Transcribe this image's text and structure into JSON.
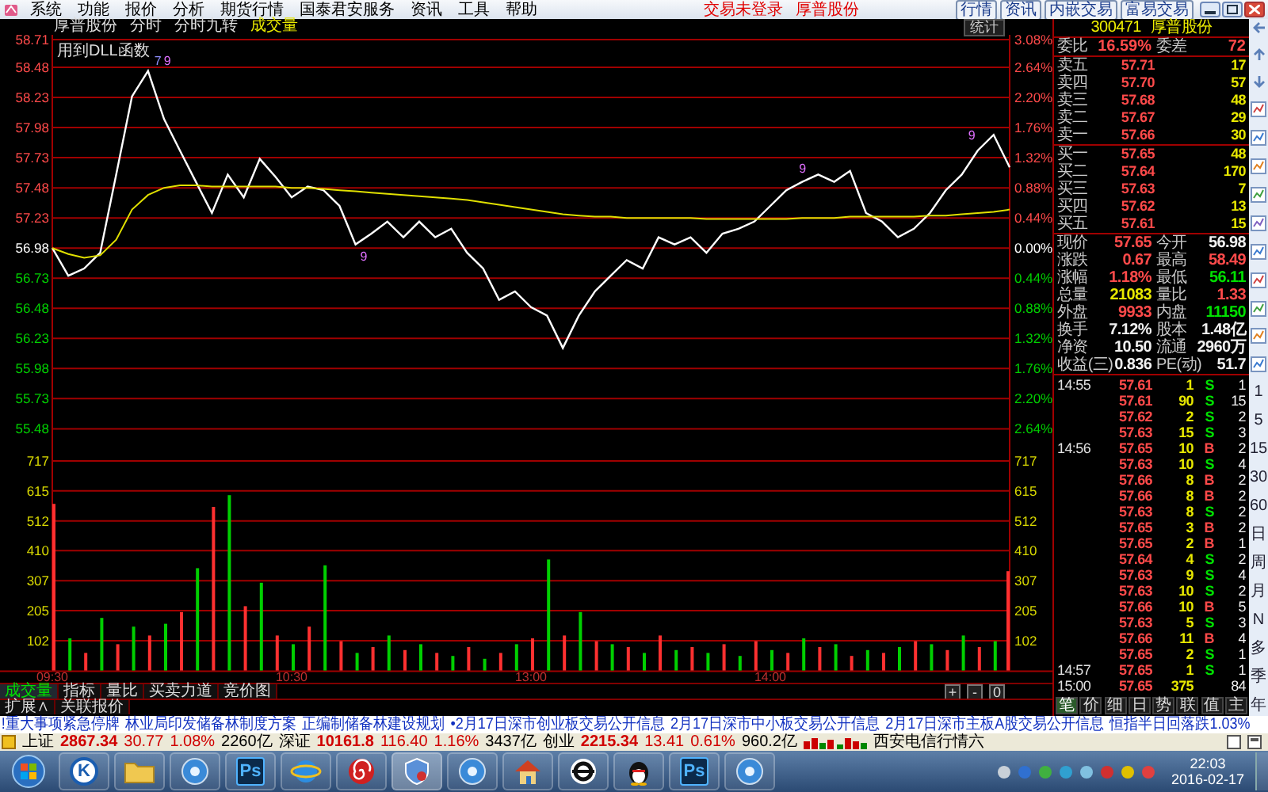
{
  "menu": {
    "items": [
      "系统",
      "功能",
      "报价",
      "分析",
      "期货行情",
      "国泰君安服务",
      "资讯",
      "工具",
      "帮助"
    ],
    "status": [
      "交易未登录",
      "厚普股份"
    ],
    "buttons": [
      "行情",
      "资讯",
      "内嵌交易",
      "富易交易"
    ]
  },
  "chart_header": {
    "title": "厚普股份",
    "items": [
      "分时",
      "分时九转"
    ],
    "indicator": "成交量",
    "stats_button": "统计",
    "note": "用到DLL函数"
  },
  "price_chart": {
    "chart_data": {
      "type": "line",
      "grid": true,
      "categories": [
        null,
        null,
        null,
        null,
        null,
        null,
        null,
        null,
        null,
        null,
        null,
        null,
        null,
        null,
        null,
        null,
        null,
        null,
        null,
        null,
        null,
        null,
        null,
        null,
        null,
        null,
        null,
        null,
        null,
        null,
        null,
        null,
        null,
        null,
        null,
        null,
        null,
        null,
        null,
        null,
        null,
        null,
        null,
        null,
        null,
        null,
        null,
        null,
        null,
        null,
        null,
        null,
        null,
        null,
        null,
        null,
        null,
        null,
        null,
        null,
        null
      ],
      "ylim": [
        55.48,
        58.71
      ],
      "series": [
        {
          "color": "#ffffff",
          "values": [
            56.98,
            56.75,
            56.81,
            56.94,
            57.59,
            58.24,
            58.45,
            58.05,
            57.79,
            57.53,
            57.27,
            57.59,
            57.4,
            57.72,
            57.57,
            57.4,
            57.49,
            57.46,
            57.33,
            57.01,
            57.1,
            57.2,
            57.07,
            57.2,
            57.07,
            57.14,
            56.94,
            56.81,
            56.55,
            56.62,
            56.49,
            56.42,
            56.15,
            56.42,
            56.62,
            56.75,
            56.88,
            56.81,
            57.07,
            57.01,
            57.07,
            56.94,
            57.1,
            57.14,
            57.2,
            57.33,
            57.46,
            57.53,
            57.59,
            57.53,
            57.62,
            57.27,
            57.2,
            57.07,
            57.14,
            57.27,
            57.46,
            57.59,
            57.79,
            57.92,
            57.65
          ]
        },
        {
          "color": "#e0e000",
          "values": [
            56.98,
            56.93,
            56.9,
            56.92,
            57.05,
            57.3,
            57.42,
            57.48,
            57.5,
            57.5,
            57.49,
            57.49,
            57.49,
            57.49,
            57.49,
            57.48,
            57.48,
            57.47,
            57.46,
            57.45,
            57.44,
            57.43,
            57.42,
            57.41,
            57.4,
            57.39,
            57.38,
            57.36,
            57.34,
            57.32,
            57.3,
            57.28,
            57.26,
            57.25,
            57.24,
            57.24,
            57.23,
            57.23,
            57.23,
            57.23,
            57.23,
            57.22,
            57.22,
            57.22,
            57.22,
            57.22,
            57.22,
            57.23,
            57.23,
            57.23,
            57.24,
            57.24,
            57.24,
            57.24,
            57.24,
            57.25,
            57.25,
            57.26,
            57.27,
            57.28,
            57.3
          ]
        }
      ],
      "yticks": [
        58.71,
        58.48,
        58.23,
        57.98,
        57.73,
        57.48,
        57.23,
        56.98,
        56.73,
        56.48,
        56.23,
        55.98,
        55.73,
        55.48
      ],
      "annotations": [
        "7",
        "9",
        "9",
        "9",
        "9"
      ]
    },
    "pct_axis": [
      {
        "label": "3.08%",
        "color": "#ff4a4a"
      },
      {
        "label": "2.64%",
        "color": "#ff4a4a"
      },
      {
        "label": "2.20%",
        "color": "#ff4a4a"
      },
      {
        "label": "1.76%",
        "color": "#ff4a4a"
      },
      {
        "label": "1.32%",
        "color": "#ff4a4a"
      },
      {
        "label": "0.88%",
        "color": "#ff4a4a"
      },
      {
        "label": "0.44%",
        "color": "#ff4a4a"
      },
      {
        "label": "0.00%",
        "color": "#ffffff"
      },
      {
        "label": "0.44%",
        "color": "#00d000"
      },
      {
        "label": "0.88%",
        "color": "#00d000"
      },
      {
        "label": "1.32%",
        "color": "#00d000"
      },
      {
        "label": "1.76%",
        "color": "#00d000"
      },
      {
        "label": "2.20%",
        "color": "#00d000"
      },
      {
        "label": "2.64%",
        "color": "#00d000"
      }
    ]
  },
  "volume_chart": {
    "right_axis": [
      "717",
      "615",
      "512",
      "410",
      "307",
      "205",
      "102"
    ],
    "chart_data": {
      "type": "bar",
      "grid": true,
      "ylim": [
        0,
        717
      ],
      "categories": [
        "09:30",
        null,
        null,
        null,
        null,
        null,
        null,
        null,
        null,
        null,
        null,
        null,
        null,
        null,
        null,
        "10:30",
        null,
        null,
        null,
        null,
        null,
        null,
        null,
        null,
        null,
        null,
        null,
        null,
        null,
        null,
        "13:00",
        null,
        null,
        null,
        null,
        null,
        null,
        null,
        null,
        null,
        null,
        null,
        null,
        null,
        null,
        "14:00",
        null,
        null,
        null,
        null,
        null,
        null,
        null,
        null,
        null,
        null,
        null,
        null,
        null,
        null,
        null
      ],
      "series": [
        {
          "color": "#ff3030",
          "values": [
            570,
            null,
            60,
            null,
            90,
            null,
            120,
            null,
            200,
            null,
            560,
            null,
            220,
            null,
            120,
            null,
            150,
            null,
            100,
            null,
            80,
            null,
            70,
            null,
            60,
            null,
            80,
            null,
            60,
            null,
            110,
            null,
            120,
            null,
            100,
            null,
            80,
            null,
            120,
            null,
            80,
            null,
            90,
            null,
            100,
            null,
            60,
            null,
            80,
            null,
            50,
            null,
            60,
            null,
            100,
            null,
            70,
            null,
            80,
            null,
            340
          ]
        },
        {
          "color": "#00d000",
          "values": [
            null,
            110,
            null,
            180,
            null,
            150,
            null,
            160,
            null,
            350,
            null,
            600,
            null,
            300,
            null,
            90,
            null,
            360,
            null,
            60,
            null,
            120,
            null,
            90,
            null,
            50,
            null,
            40,
            null,
            90,
            null,
            380,
            null,
            200,
            null,
            90,
            null,
            60,
            null,
            70,
            null,
            60,
            null,
            50,
            null,
            70,
            null,
            110,
            null,
            90,
            null,
            70,
            null,
            80,
            null,
            90,
            null,
            120,
            null,
            100,
            null
          ]
        }
      ],
      "yticks": [
        717,
        615,
        512,
        410,
        307,
        205,
        102
      ]
    }
  },
  "bottom_tabs": [
    {
      "label": "成交量",
      "selected": true
    },
    {
      "label": "指标",
      "selected": false
    },
    {
      "label": "量比",
      "selected": false
    },
    {
      "label": "买卖力道",
      "selected": false
    },
    {
      "label": "竞价图",
      "selected": false
    }
  ],
  "zoom_buttons": [
    "+",
    "-",
    "0"
  ],
  "bottom_links": [
    "扩展∧",
    "关联报价"
  ],
  "quote": {
    "code": "300471",
    "name": "厚普股份",
    "order_ratio": [
      {
        "label": "委比",
        "value": "16.59%"
      },
      {
        "label": "委差",
        "value": "72"
      }
    ],
    "asks": [
      {
        "label": "卖五",
        "price": "57.71",
        "volume": "17"
      },
      {
        "label": "卖四",
        "price": "57.70",
        "volume": "57"
      },
      {
        "label": "卖三",
        "price": "57.68",
        "volume": "48"
      },
      {
        "label": "卖二",
        "price": "57.67",
        "volume": "29"
      },
      {
        "label": "卖一",
        "price": "57.66",
        "volume": "30"
      }
    ],
    "bids": [
      {
        "label": "买一",
        "price": "57.65",
        "volume": "48"
      },
      {
        "label": "买二",
        "price": "57.64",
        "volume": "170"
      },
      {
        "label": "买三",
        "price": "57.63",
        "volume": "7"
      },
      {
        "label": "买四",
        "price": "57.62",
        "volume": "13"
      },
      {
        "label": "买五",
        "price": "57.61",
        "volume": "15"
      }
    ],
    "stats": [
      [
        {
          "label": "现价",
          "value": "57.65",
          "color": "#ff4a4a"
        },
        {
          "label": "今开",
          "value": "56.98",
          "color": "#f0f0f0"
        }
      ],
      [
        {
          "label": "涨跌",
          "value": "0.67",
          "color": "#ff4a4a"
        },
        {
          "label": "最高",
          "value": "58.49",
          "color": "#ff4a4a"
        }
      ],
      [
        {
          "label": "涨幅",
          "value": "1.18%",
          "color": "#ff4a4a"
        },
        {
          "label": "最低",
          "value": "56.11",
          "color": "#00e000"
        }
      ],
      [
        {
          "label": "总量",
          "value": "21083",
          "color": "#e8e800"
        },
        {
          "label": "量比",
          "value": "1.33",
          "color": "#ff4a4a"
        }
      ],
      [
        {
          "label": "外盘",
          "value": "9933",
          "color": "#ff4a4a"
        },
        {
          "label": "内盘",
          "value": "11150",
          "color": "#00e000"
        }
      ],
      [
        {
          "label": "换手",
          "value": "7.12%",
          "color": "#f0f0f0"
        },
        {
          "label": "股本",
          "value": "1.48亿",
          "color": "#f0f0f0"
        }
      ],
      [
        {
          "label": "净资",
          "value": "10.50",
          "color": "#f0f0f0"
        },
        {
          "label": "流通",
          "value": "2960万",
          "color": "#f0f0f0"
        }
      ],
      [
        {
          "label": "收益(三)",
          "value": "0.836",
          "color": "#f0f0f0"
        },
        {
          "label": "PE(动)",
          "value": "51.7",
          "color": "#f0f0f0"
        }
      ]
    ],
    "ticks": [
      {
        "time": "14:55",
        "price": "57.61",
        "volume": "1",
        "side": "S",
        "kind": "sell",
        "count": "1"
      },
      {
        "price": "57.61",
        "volume": "90",
        "side": "S",
        "kind": "sell",
        "count": "15"
      },
      {
        "price": "57.62",
        "volume": "2",
        "side": "S",
        "kind": "sell",
        "count": "2"
      },
      {
        "price": "57.63",
        "volume": "15",
        "side": "S",
        "kind": "sell",
        "count": "3"
      },
      {
        "time": "14:56",
        "price": "57.65",
        "volume": "10",
        "side": "B",
        "kind": "buy",
        "count": "2"
      },
      {
        "price": "57.63",
        "volume": "10",
        "side": "S",
        "kind": "sell",
        "count": "4"
      },
      {
        "price": "57.66",
        "volume": "8",
        "side": "B",
        "kind": "buy",
        "count": "2"
      },
      {
        "price": "57.66",
        "volume": "8",
        "side": "B",
        "kind": "buy",
        "count": "2"
      },
      {
        "price": "57.63",
        "volume": "8",
        "side": "S",
        "kind": "sell",
        "count": "2"
      },
      {
        "price": "57.65",
        "volume": "3",
        "side": "B",
        "kind": "buy",
        "count": "2"
      },
      {
        "price": "57.65",
        "volume": "2",
        "side": "B",
        "kind": "buy",
        "count": "1"
      },
      {
        "price": "57.64",
        "volume": "4",
        "side": "S",
        "kind": "sell",
        "count": "2"
      },
      {
        "price": "57.63",
        "volume": "9",
        "side": "S",
        "kind": "sell",
        "count": "4"
      },
      {
        "price": "57.63",
        "volume": "10",
        "side": "S",
        "kind": "sell",
        "count": "2"
      },
      {
        "price": "57.66",
        "volume": "10",
        "side": "B",
        "kind": "buy",
        "count": "5"
      },
      {
        "price": "57.63",
        "volume": "5",
        "side": "S",
        "kind": "sell",
        "count": "3"
      },
      {
        "price": "57.66",
        "volume": "11",
        "side": "B",
        "kind": "buy",
        "count": "4"
      },
      {
        "price": "57.65",
        "volume": "2",
        "side": "S",
        "kind": "sell",
        "count": "1"
      },
      {
        "time": "14:57",
        "price": "57.65",
        "volume": "1",
        "side": "S",
        "kind": "sell",
        "count": "1"
      },
      {
        "time": "15:00",
        "price": "57.65",
        "volume": "375",
        "count": "84"
      }
    ],
    "view_buttons": [
      {
        "label": "笔",
        "selected": true
      },
      {
        "label": "价",
        "selected": false
      },
      {
        "label": "细",
        "selected": false
      },
      {
        "label": "日",
        "selected": false
      },
      {
        "label": "势",
        "selected": false
      },
      {
        "label": "联",
        "selected": false
      },
      {
        "label": "值",
        "selected": false
      },
      {
        "label": "主",
        "selected": false
      }
    ]
  },
  "periods": [
    "1",
    "5",
    "15",
    "30",
    "60",
    "日",
    "周",
    "月",
    "N",
    "多",
    "季",
    "年"
  ],
  "ticker": [
    "!重大事项紧急停牌",
    "林业局印发储备林制度方案",
    "正编制储备林建设规划",
    "•2月17日深市创业板交易公开信息",
    "2月17日深市中小板交易公开信息",
    "2月17日深市主板A股交易公开信息",
    "恒指半日回落跌1.03%"
  ],
  "indices": [
    {
      "name": "上证",
      "value": "2867.34",
      "change": "30.77",
      "pct": "1.08%",
      "amount": "2260亿"
    },
    {
      "name": "深证",
      "value": "10161.8",
      "change": "116.40",
      "pct": "1.16%",
      "amount": "3437亿"
    },
    {
      "name": "创业",
      "value": "2215.34",
      "change": "13.41",
      "pct": "0.61%",
      "amount": "960.2亿"
    }
  ],
  "server": "西安电信行情六",
  "taskbar": {
    "apps": [
      {
        "kind": "letter",
        "glyph": "K"
      },
      {
        "kind": "folder"
      },
      {
        "kind": "disc"
      },
      {
        "kind": "ps",
        "glyph": "Ps"
      },
      {
        "kind": "globe"
      },
      {
        "kind": "spiral"
      },
      {
        "kind": "shield"
      },
      {
        "kind": "disc"
      },
      {
        "kind": "house"
      },
      {
        "kind": "ring"
      },
      {
        "kind": "penguin"
      },
      {
        "kind": "ps",
        "glyph": "Ps"
      },
      {
        "kind": "disc"
      }
    ],
    "time": "22:03",
    "date": "2016-02-17"
  }
}
